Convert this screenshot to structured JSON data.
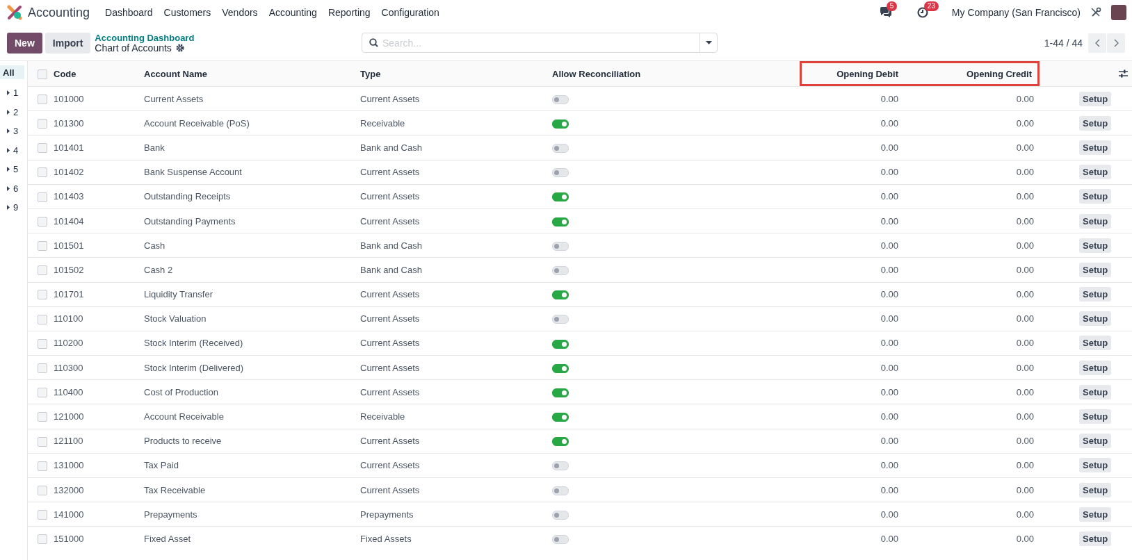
{
  "navbar": {
    "app_name": "Accounting",
    "menu": [
      "Dashboard",
      "Customers",
      "Vendors",
      "Accounting",
      "Reporting",
      "Configuration"
    ],
    "messages_badge": "5",
    "activities_badge": "23",
    "company": "My Company (San Francisco)"
  },
  "control_panel": {
    "buttons": [
      "New",
      "Import"
    ],
    "breadcrumb": "Accounting Dashboard",
    "title": "Chart of Accounts",
    "search": {
      "placeholder": "Search..."
    },
    "pager": "1-44 / 44"
  },
  "sidebar": {
    "items": [
      {
        "label": "All",
        "kind": "all",
        "selected": true
      },
      {
        "label": "1",
        "kind": "group",
        "selected": false
      },
      {
        "label": "2",
        "kind": "group",
        "selected": false
      },
      {
        "label": "3",
        "kind": "group",
        "selected": false
      },
      {
        "label": "4",
        "kind": "group",
        "selected": false
      },
      {
        "label": "5",
        "kind": "group",
        "selected": false
      },
      {
        "label": "6",
        "kind": "group",
        "selected": false
      },
      {
        "label": "9",
        "kind": "group",
        "selected": false
      }
    ]
  },
  "table": {
    "all_selected": false,
    "columns": [
      {
        "label": "Code",
        "highlighted": false
      },
      {
        "label": "Account Name",
        "highlighted": false
      },
      {
        "label": "Type",
        "highlighted": false
      },
      {
        "label": "Allow Reconciliation",
        "highlighted": false
      },
      {
        "label": "Opening Debit",
        "highlighted": true
      },
      {
        "label": "Opening Credit",
        "highlighted": true
      }
    ],
    "rows": [
      {
        "selected": false,
        "code": "101000",
        "name": "Current Assets",
        "type": "Current Assets",
        "reconcile": false,
        "debit": "0.00",
        "credit": "0.00",
        "action": "Setup"
      },
      {
        "selected": false,
        "code": "101300",
        "name": "Account Receivable (PoS)",
        "type": "Receivable",
        "reconcile": true,
        "debit": "0.00",
        "credit": "0.00",
        "action": "Setup"
      },
      {
        "selected": false,
        "code": "101401",
        "name": "Bank",
        "type": "Bank and Cash",
        "reconcile": false,
        "debit": "0.00",
        "credit": "0.00",
        "action": "Setup"
      },
      {
        "selected": false,
        "code": "101402",
        "name": "Bank Suspense Account",
        "type": "Current Assets",
        "reconcile": false,
        "debit": "0.00",
        "credit": "0.00",
        "action": "Setup"
      },
      {
        "selected": false,
        "code": "101403",
        "name": "Outstanding Receipts",
        "type": "Current Assets",
        "reconcile": true,
        "debit": "0.00",
        "credit": "0.00",
        "action": "Setup"
      },
      {
        "selected": false,
        "code": "101404",
        "name": "Outstanding Payments",
        "type": "Current Assets",
        "reconcile": true,
        "debit": "0.00",
        "credit": "0.00",
        "action": "Setup"
      },
      {
        "selected": false,
        "code": "101501",
        "name": "Cash",
        "type": "Bank and Cash",
        "reconcile": false,
        "debit": "0.00",
        "credit": "0.00",
        "action": "Setup"
      },
      {
        "selected": false,
        "code": "101502",
        "name": "Cash 2",
        "type": "Bank and Cash",
        "reconcile": false,
        "debit": "0.00",
        "credit": "0.00",
        "action": "Setup"
      },
      {
        "selected": false,
        "code": "101701",
        "name": "Liquidity Transfer",
        "type": "Current Assets",
        "reconcile": true,
        "debit": "0.00",
        "credit": "0.00",
        "action": "Setup"
      },
      {
        "selected": false,
        "code": "110100",
        "name": "Stock Valuation",
        "type": "Current Assets",
        "reconcile": false,
        "debit": "0.00",
        "credit": "0.00",
        "action": "Setup"
      },
      {
        "selected": false,
        "code": "110200",
        "name": "Stock Interim (Received)",
        "type": "Current Assets",
        "reconcile": true,
        "debit": "0.00",
        "credit": "0.00",
        "action": "Setup"
      },
      {
        "selected": false,
        "code": "110300",
        "name": "Stock Interim (Delivered)",
        "type": "Current Assets",
        "reconcile": true,
        "debit": "0.00",
        "credit": "0.00",
        "action": "Setup"
      },
      {
        "selected": false,
        "code": "110400",
        "name": "Cost of Production",
        "type": "Current Assets",
        "reconcile": true,
        "debit": "0.00",
        "credit": "0.00",
        "action": "Setup"
      },
      {
        "selected": false,
        "code": "121000",
        "name": "Account Receivable",
        "type": "Receivable",
        "reconcile": true,
        "debit": "0.00",
        "credit": "0.00",
        "action": "Setup"
      },
      {
        "selected": false,
        "code": "121100",
        "name": "Products to receive",
        "type": "Current Assets",
        "reconcile": true,
        "debit": "0.00",
        "credit": "0.00",
        "action": "Setup"
      },
      {
        "selected": false,
        "code": "131000",
        "name": "Tax Paid",
        "type": "Current Assets",
        "reconcile": false,
        "debit": "0.00",
        "credit": "0.00",
        "action": "Setup"
      },
      {
        "selected": false,
        "code": "132000",
        "name": "Tax Receivable",
        "type": "Current Assets",
        "reconcile": false,
        "debit": "0.00",
        "credit": "0.00",
        "action": "Setup"
      },
      {
        "selected": false,
        "code": "141000",
        "name": "Prepayments",
        "type": "Prepayments",
        "reconcile": false,
        "debit": "0.00",
        "credit": "0.00",
        "action": "Setup"
      },
      {
        "selected": false,
        "code": "151000",
        "name": "Fixed Asset",
        "type": "Fixed Assets",
        "reconcile": false,
        "debit": "0.00",
        "credit": "0.00",
        "action": "Setup"
      }
    ]
  }
}
